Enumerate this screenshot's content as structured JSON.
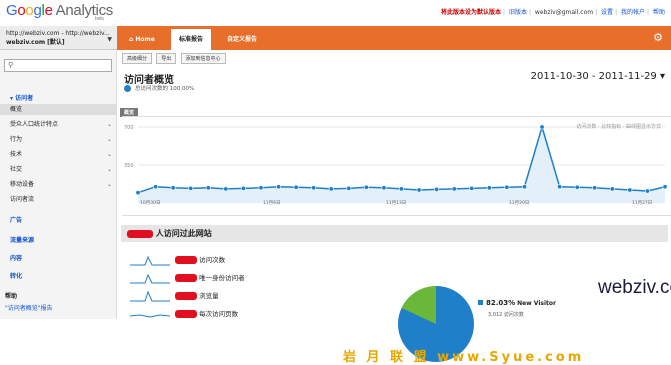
{
  "header": {
    "logo": "Google Analytics",
    "logo_beta": "beta",
    "link_set_default": "将此版本设为默认版本",
    "link_old": "旧版本",
    "email": "webziv@gmail.com",
    "settings": "设置",
    "my_account": "我的帐户",
    "help": "帮助"
  },
  "account": {
    "line1": "http://webziv.com - http://webziv...",
    "line2": "webziv.com [默认]"
  },
  "nav": {
    "home": "Home",
    "standard": "标准报告",
    "custom": "自定义报告"
  },
  "sidebar": {
    "search_placeholder": "",
    "group": "访问者",
    "items": [
      "概览",
      "受众人口统计特点",
      "行为",
      "技术",
      "社交",
      "移动设备",
      "访问者流"
    ],
    "sections": [
      "广告",
      "流量来源",
      "内容",
      "转化"
    ],
    "help_title": "帮助",
    "help_link": "\"访问者概览\"报告"
  },
  "toolbar": {
    "btn1": "高级细分",
    "btn2": "导出",
    "btn3": "添加到信息中心"
  },
  "report": {
    "title": "访问者概览",
    "subtitle": "总访问次数的 100.00%",
    "date_range": "2011-10-30 - 2011-11-29",
    "overview_tab": "概览",
    "graph_opts": "曲线图显示方式",
    "metric_label": "访问次数",
    "compare": "比较指标",
    "ylabels": [
      "700",
      "350"
    ],
    "xlabels": [
      "10月30日",
      "11月6日",
      "11月13日",
      "11月20日",
      "11月27日"
    ]
  },
  "summary": {
    "head_suffix": "人访问过此网站",
    "metrics": [
      {
        "label": "访问次数"
      },
      {
        "label": "唯一身份访问者"
      },
      {
        "label": "浏览量"
      },
      {
        "label": "每次访问页数"
      }
    ]
  },
  "pie": {
    "pct": "82.03%",
    "label": "New Visitor",
    "sub": "3,012 访问次数"
  },
  "watermark": {
    "site": "webziv.com",
    "cn": "岩 月 联 盟  www.Syue.com"
  },
  "chart_data": {
    "type": "area",
    "xlabels": [
      "10月30日",
      "11月6日",
      "11月13日",
      "11月20日",
      "11月27日"
    ],
    "values": [
      95,
      150,
      140,
      135,
      140,
      130,
      135,
      140,
      150,
      145,
      140,
      130,
      135,
      145,
      140,
      130,
      120,
      125,
      130,
      135,
      140,
      145,
      150,
      700,
      150,
      145,
      140,
      130,
      120,
      110,
      150
    ],
    "ylim": [
      0,
      700
    ],
    "ylabels": [
      "700",
      "350"
    ],
    "color": "#1f7fc8"
  }
}
